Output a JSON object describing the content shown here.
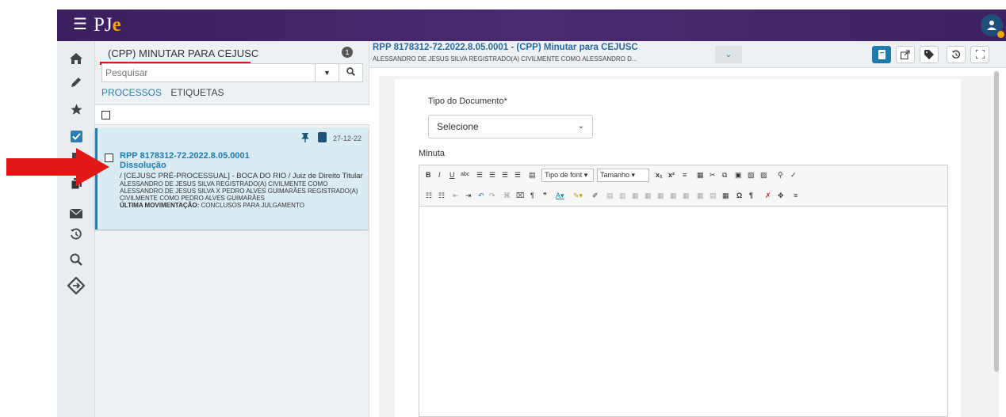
{
  "app": {
    "logo_p": "PJ",
    "logo_e": "e",
    "menu_icon": "hamburger-icon",
    "avatar_icon": "user-icon"
  },
  "nav": {
    "items": [
      "home-icon",
      "pencil-icon",
      "star-icon",
      "checkbox-icon",
      "document-icon",
      "copy-icon",
      "envelope-icon",
      "history-icon",
      "search-icon",
      "diamond-arrows-icon"
    ]
  },
  "tasklist": {
    "title": "(CPP) MINUTAR PARA CEJUSC",
    "count": "1",
    "search": {
      "placeholder": "Pesquisar"
    },
    "tabs": [
      "PROCESSOS",
      "ETIQUETAS"
    ]
  },
  "card": {
    "date": "27-12-22",
    "number": "RPP 8178312-72.2022.8.05.0001",
    "classe": "Dissolução",
    "orgao": "/ [CEJUSC PRÉ-PROCESSUAL] - BOCA DO RIO / Juiz de Direito Titular",
    "partes": "ALESSANDRO DE JESUS SILVA REGISTRADO(A) CIVILMENTE COMO ALESSANDRO DE JESUS SILVA X PEDRO ALVES GUIMARÃES REGISTRADO(A) CIVILMENTE COMO PEDRO ALVES GUIMARÃES",
    "ultima_label": "ÚLTIMA MOVIMENTAÇÃO:",
    "ultima_value": "CONCLUSOS PARA JULGAMENTO"
  },
  "header": {
    "title": "RPP 8178312-72.2022.8.05.0001 - (CPP) Minutar para CEJUSC",
    "subtitle": "ALESSANDRO DE JESUS SILVA REGISTRADO(A) CIVILMENTE COMO ALESSANDRO D..."
  },
  "form": {
    "tipo_label": "Tipo do Documento*",
    "tipo_value": "Selecione",
    "minuta_label": "Minuta",
    "font_select": "Tipo de font",
    "size_select": "Tamanho"
  },
  "colors": {
    "topbar": "#3b1f5e",
    "accent": "#1f7aae",
    "arrow": "#e01818",
    "card_bg": "#d9ebf3"
  }
}
